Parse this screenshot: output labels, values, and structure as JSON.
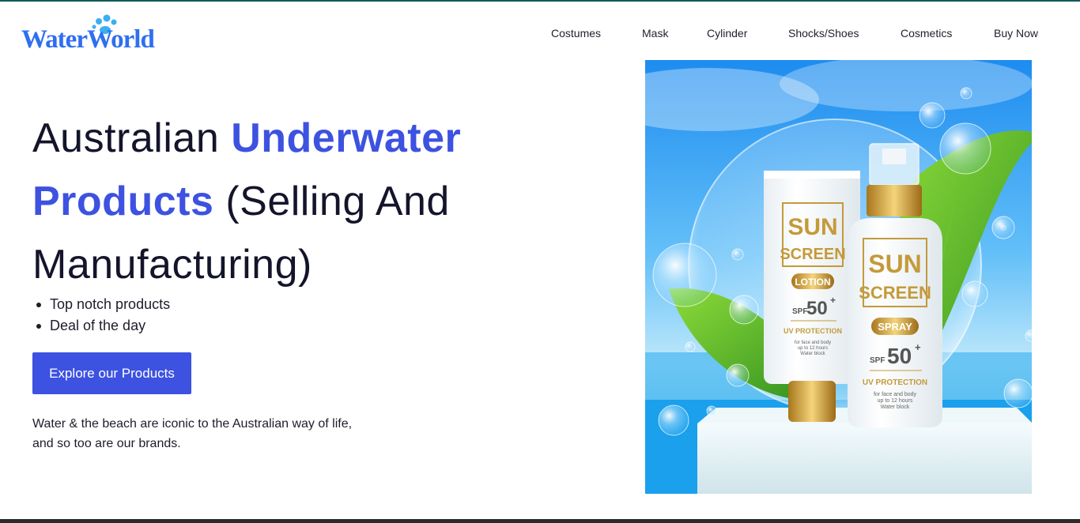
{
  "brand": {
    "name": "WaterWorld",
    "color": "#2f6ff0"
  },
  "nav": {
    "items": [
      "Costumes",
      "Mask",
      "Cylinder",
      "Shocks/Shoes",
      "Cosmetics",
      "Buy Now"
    ]
  },
  "hero": {
    "title_part1": "Australian ",
    "title_accent1": "Underwater",
    "title_accent2": "Products",
    "title_part2": " (Selling And Manufacturing)",
    "accent_color": "#3d52e0",
    "bullets": [
      "Top notch products",
      "Deal of the day"
    ],
    "cta_label": "Explore our Products",
    "tagline_line1": "Water & the beach are iconic to the Australian way of life,",
    "tagline_line2": "and so too are our brands."
  },
  "product_image": {
    "lotion": {
      "brand_line1": "SUN",
      "brand_line2": "SCREEN",
      "type": "LOTION",
      "spf_prefix": "SPF",
      "spf_value": "50",
      "spf_suffix": "+",
      "protection": "UV PROTECTION",
      "fine_print": [
        "for face and body",
        "up to 12 hours",
        "Water block"
      ]
    },
    "spray": {
      "brand_line1": "SUN",
      "brand_line2": "SCREEN",
      "type": "SPRAY",
      "spf_prefix": "SPF",
      "spf_value": "50",
      "spf_suffix": "+",
      "protection": "UV PROTECTION",
      "fine_print": [
        "for face and body",
        "up to 12 hours",
        "Water block"
      ]
    }
  }
}
